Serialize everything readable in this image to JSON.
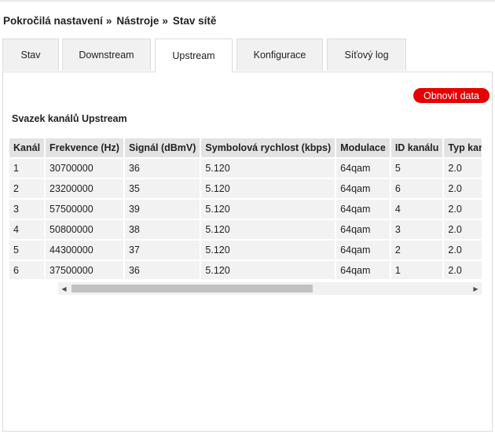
{
  "breadcrumb": {
    "items": [
      "Pokročilá nastavení",
      "Nástroje",
      "Stav sítě"
    ],
    "separator": "»"
  },
  "tabs": [
    {
      "label": "Stav",
      "active": false
    },
    {
      "label": "Downstream",
      "active": false
    },
    {
      "label": "Upstream",
      "active": true
    },
    {
      "label": "Konfigurace",
      "active": false
    },
    {
      "label": "Síťový log",
      "active": false
    }
  ],
  "actions": {
    "refresh_label": "Obnovit data"
  },
  "section": {
    "title": "Svazek kanálů Upstream"
  },
  "table": {
    "headers": [
      "Kanál",
      "Frekvence (Hz)",
      "Signál (dBmV)",
      "Symbolová rychlost (kbps)",
      "Modulace",
      "ID kanálu",
      "Typ kanálu"
    ],
    "rows": [
      [
        "1",
        "30700000",
        "36",
        "5.120",
        "64qam",
        "5",
        "2.0"
      ],
      [
        "2",
        "23200000",
        "35",
        "5.120",
        "64qam",
        "6",
        "2.0"
      ],
      [
        "3",
        "57500000",
        "39",
        "5.120",
        "64qam",
        "4",
        "2.0"
      ],
      [
        "4",
        "50800000",
        "38",
        "5.120",
        "64qam",
        "3",
        "2.0"
      ],
      [
        "5",
        "44300000",
        "37",
        "5.120",
        "64qam",
        "2",
        "2.0"
      ],
      [
        "6",
        "37500000",
        "36",
        "5.120",
        "64qam",
        "1",
        "2.0"
      ]
    ]
  },
  "scrollbar": {
    "left_icon": "triangle-left-icon",
    "right_icon": "triangle-right-icon"
  },
  "colors": {
    "accent": "#e60000",
    "tab_bg": "#f1f1f1",
    "header_bg": "#e3e3e3",
    "cell_bg": "#f2f2f2"
  }
}
